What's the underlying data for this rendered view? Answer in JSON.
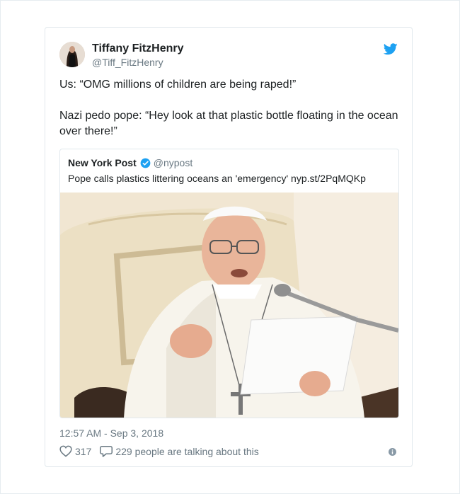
{
  "tweet": {
    "author_name": "Tiffany FitzHenry",
    "author_handle": "@Tiff_FitzHenry",
    "text_line1": "Us: “OMG millions of children are being raped!”",
    "text_line2": "Nazi pedo pope: “Hey look at that plastic bottle floating in the ocean over there!”",
    "timestamp": "12:57 AM - Sep 3, 2018",
    "likes": "317",
    "replies_label": "229 people are talking about this"
  },
  "quote": {
    "author_name": "New York Post",
    "author_handle": "@nypost",
    "text": "Pope calls plastics littering oceans an 'emergency' nyp.st/2PqMQKp"
  },
  "colors": {
    "twitter_blue": "#1da1f2",
    "secondary_text": "#697882",
    "border": "#e1e8ed"
  },
  "icons": [
    "twitter-bird-icon",
    "verified-badge-icon",
    "heart-icon",
    "reply-icon",
    "info-icon"
  ]
}
